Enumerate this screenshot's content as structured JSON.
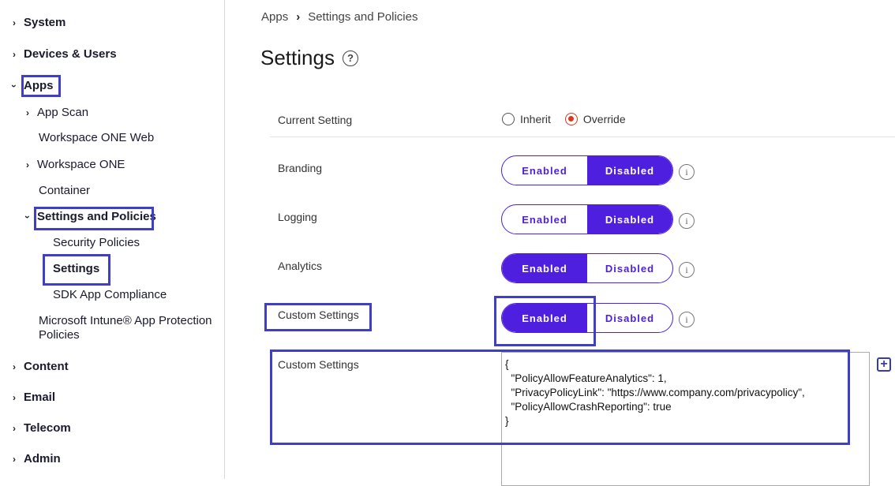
{
  "sidebar": {
    "system": "System",
    "devices_users": "Devices & Users",
    "apps": "Apps",
    "app_scan": "App Scan",
    "workspace_one_web": "Workspace ONE Web",
    "workspace_one": "Workspace ONE",
    "container": "Container",
    "settings_policies": "Settings and Policies",
    "security_policies": "Security Policies",
    "settings": "Settings",
    "sdk_compliance": "SDK App Compliance",
    "intune_line1": "Microsoft Intune® App Protection",
    "intune_line2": "Policies",
    "content": "Content",
    "email": "Email",
    "telecom": "Telecom",
    "admin": "Admin"
  },
  "breadcrumb": {
    "apps": "Apps",
    "current": "Settings and Policies"
  },
  "page": {
    "title": "Settings"
  },
  "form": {
    "current_setting_label": "Current Setting",
    "inherit": "Inherit",
    "override": "Override",
    "selected_mode": "Override",
    "branding_label": "Branding",
    "logging_label": "Logging",
    "analytics_label": "Analytics",
    "custom_settings_toggle_label": "Custom Settings",
    "custom_settings_field_label": "Custom Settings",
    "enabled": "Enabled",
    "disabled": "Disabled",
    "branding_value": "Disabled",
    "logging_value": "Disabled",
    "analytics_value": "Enabled",
    "custom_settings_value": "Enabled",
    "json_lines": [
      "{",
      "  \"PolicyAllowFeatureAnalytics\": 1,",
      "  \"PrivacyPolicyLink\": \"https://www.company.com/privacypolicy\",",
      "  \"PolicyAllowCrashReporting\": true",
      "}"
    ]
  },
  "colors": {
    "accent": "#4f1fe0",
    "annotation": "#3e3fc4",
    "radio_selected": "#d9381e"
  }
}
